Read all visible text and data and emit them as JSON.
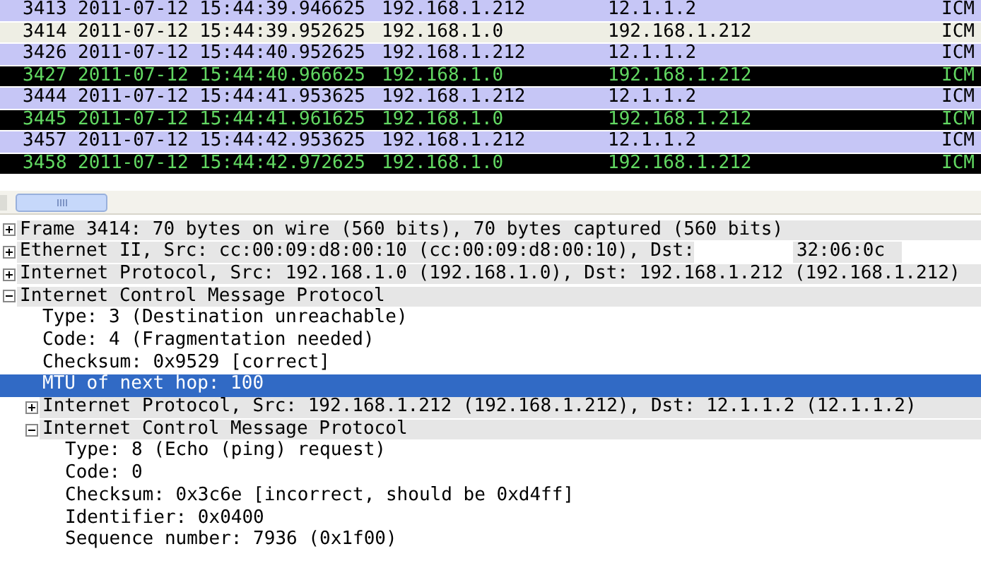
{
  "packet_list": [
    {
      "no": "3413",
      "time": "2011-07-12 15:44:39.946625",
      "source": "192.168.1.212",
      "destination": "12.1.1.2",
      "protocol": "ICM",
      "color": "#c6c6f6"
    },
    {
      "no": "3414",
      "time": "2011-07-12 15:44:39.952625",
      "source": "192.168.1.0",
      "destination": "192.168.1.212",
      "protocol": "ICM",
      "color": "#eeeee4"
    },
    {
      "no": "3426",
      "time": "2011-07-12 15:44:40.952625",
      "source": "192.168.1.212",
      "destination": "12.1.1.2",
      "protocol": "ICM",
      "color": "#c6c6f6"
    },
    {
      "no": "3427",
      "time": "2011-07-12 15:44:40.966625",
      "source": "192.168.1.0",
      "destination": "192.168.1.212",
      "protocol": "ICM",
      "color": "#000000"
    },
    {
      "no": "3444",
      "time": "2011-07-12 15:44:41.953625",
      "source": "192.168.1.212",
      "destination": "12.1.1.2",
      "protocol": "ICM",
      "color": "#c6c6f6"
    },
    {
      "no": "3445",
      "time": "2011-07-12 15:44:41.961625",
      "source": "192.168.1.0",
      "destination": "192.168.1.212",
      "protocol": "ICM",
      "color": "#000000"
    },
    {
      "no": "3457",
      "time": "2011-07-12 15:44:42.953625",
      "source": "192.168.1.212",
      "destination": "12.1.1.2",
      "protocol": "ICM",
      "color": "#c6c6f6"
    },
    {
      "no": "3458",
      "time": "2011-07-12 15:44:42.972625",
      "source": "192.168.1.0",
      "destination": "192.168.1.212",
      "protocol": "ICM",
      "color": "#000000"
    }
  ],
  "details": [
    {
      "label": "Frame 3414: 70 bytes on wire (560 bits), 70 bytes captured (560 bits)",
      "expanded": false,
      "selected": false
    },
    {
      "label": "Ethernet II, Src: cc:00:09:d8:00:10 (cc:00:09:d8:00:10), Dst:",
      "masked_tail": "32:06:0c",
      "expanded": false,
      "selected": false
    },
    {
      "label": "Internet Protocol, Src: 192.168.1.0 (192.168.1.0), Dst: 192.168.1.212 (192.168.1.212)",
      "expanded": false,
      "selected": false
    },
    {
      "label": "Internet Control Message Protocol",
      "expanded": true,
      "selected": false,
      "children": [
        {
          "label": "Type: 3 (Destination unreachable)",
          "selected": false
        },
        {
          "label": "Code: 4 (Fragmentation needed)",
          "selected": false
        },
        {
          "label": "Checksum: 0x9529 [correct]",
          "selected": false
        },
        {
          "label": "MTU of next hop: 100",
          "selected": true
        },
        {
          "label": "Internet Protocol, Src: 192.168.1.212 (192.168.1.212), Dst: 12.1.1.2 (12.1.1.2)",
          "expanded": false,
          "selected": false
        },
        {
          "label": "Internet Control Message Protocol",
          "expanded": true,
          "selected": false,
          "children": [
            {
              "label": "Type: 8 (Echo (ping) request)",
              "selected": false
            },
            {
              "label": "Code: 0",
              "selected": false
            },
            {
              "label": "Checksum: 0x3c6e [incorrect, should be 0xd4ff]",
              "selected": false
            },
            {
              "label": "Identifier: 0x0400",
              "selected": false
            },
            {
              "label": "Sequence number: 7936 (0x1f00)",
              "selected": false
            }
          ]
        }
      ]
    }
  ]
}
